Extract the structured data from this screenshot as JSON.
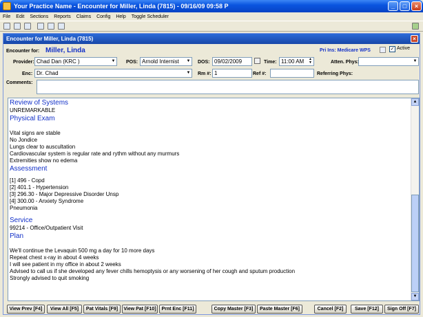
{
  "window": {
    "title": "Your Practice Name -  Encounter for Miller, Linda (7815) - 09/16/09 09:58 P"
  },
  "menu": [
    "File",
    "Edit",
    "Sections",
    "Reports",
    "Claims",
    "Config",
    "Help",
    "Toggle Scheduler"
  ],
  "inner": {
    "title": "Encounter for Miller, Linda (7815)"
  },
  "form": {
    "encounter_for_label": "Encounter for:",
    "patient_name": "Miller, Linda",
    "pri_ins": "Pri Ins: Medicare WPS",
    "active_label": "Active",
    "provider_label": "Provider:",
    "provider_value": "Chad Dan (KRC )",
    "pos_label": "POS:",
    "pos_value": "Arnold Internist",
    "dos_label": "DOS:",
    "dos_value": "09/02/2009",
    "time_label": "Time:",
    "time_value": "11:00 AM",
    "atten_label": "Atten. Phys:",
    "atten_value": "",
    "enc_label": "Enc:",
    "enc_value": "Dr. Chad",
    "rm_label": "Rm #:",
    "rm_value": "1",
    "ref_label": "Ref #:",
    "ref_value": "",
    "referring_label": "Referring Phys:",
    "comments_label": "Comments:",
    "comments_value": ""
  },
  "note": {
    "ros_heading": "Review of Systems",
    "ros_text": "UNREMARKABLE",
    "pe_heading": "Physical Exam",
    "pe_lines": [
      "Vital signs are stable",
      "No Jondice",
      "Lungs clear to auscultation",
      "Cardiovascular system is regular rate and rythm without any murmurs",
      "Extremities show no edema"
    ],
    "assessment_heading": "Assessment",
    "assessment_lines": [
      "[1] 496 - Copd",
      "[2] 401.1 - Hypertension",
      "[3] 296.30 - Major Depressive Disorder Unsp",
      "[4] 300.00 - Anxiety Syndrome",
      "Pneumonia"
    ],
    "service_heading": "Service",
    "service_text": "99214 - Office/Outpatient Visit",
    "plan_heading": "Plan",
    "plan_lines": [
      "We'll continue the Levaquin 500 mg a day for 10 more days",
      "Repeat chest x-ray in about 4 weeks",
      "I will see patient in my office in about 2 weeks",
      "Advised to call us if she developed any fever chills hemoptysis or any worsening of her cough and sputum production",
      "Strongly advised to quit smoking"
    ]
  },
  "buttons": {
    "view_prev": "View Prev [F4]",
    "view_all": "View All [F5]",
    "pat_vitals": "Pat Vitals [F9]",
    "view_pat": "View Pat [F10]",
    "prnt_enc": "Prnt Enc [F11]",
    "copy_master": "Copy Master [F3]",
    "paste_master": "Paste Master [F6]",
    "cancel": "Cancel [F2]",
    "save": "Save [F12]",
    "sign_off": "Sign Off [F7]"
  }
}
